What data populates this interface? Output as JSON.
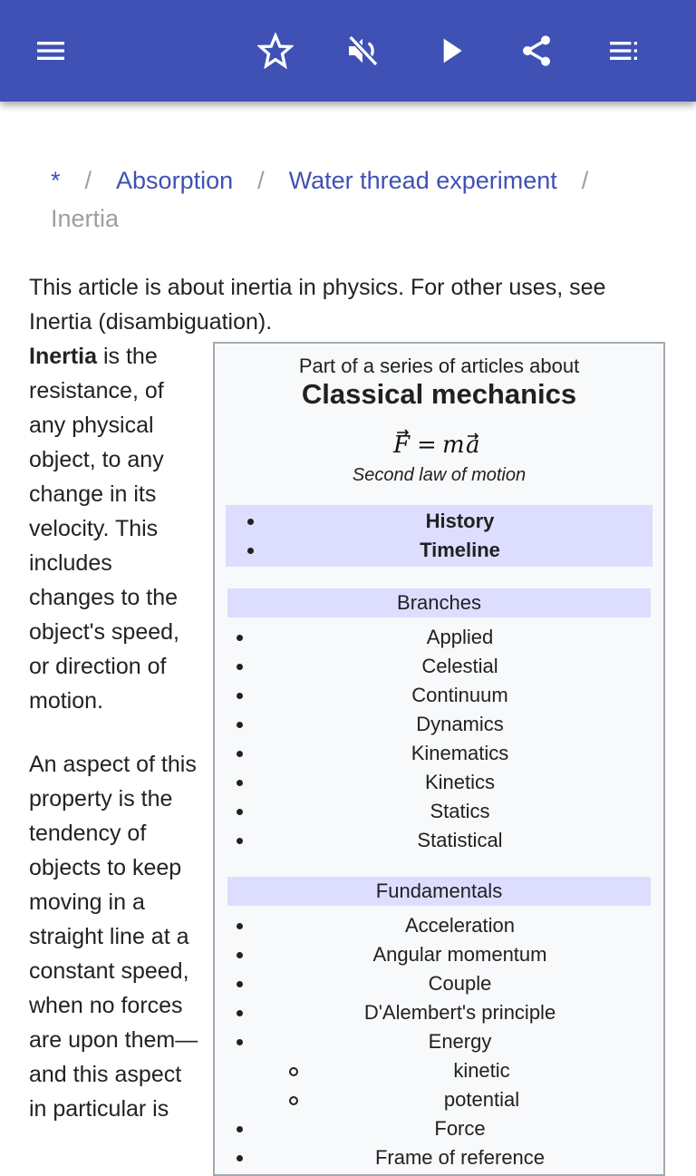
{
  "appbar": {
    "color": "#3f51b5",
    "icons": [
      "menu-icon",
      "star-icon",
      "volume-off-icon",
      "play-icon",
      "share-icon",
      "playlist-icon"
    ]
  },
  "breadcrumb": {
    "items": [
      "*",
      "Absorption",
      "Water thread experiment"
    ],
    "separator": "/",
    "current": "Inertia"
  },
  "article": {
    "hatnote": "This article is about inertia in physics. For other uses, see Inertia (disambiguation).",
    "p1_bold": "Inertia",
    "p1_rest": " is the resistance, of any physical object, to any change in its velocity. This includes changes to the object's speed, or direction of motion.",
    "p2": "An aspect of this property is the tendency of objects to keep moving in a straight line at a constant speed, when no forces are upon them—and this aspect in particular is"
  },
  "infobox": {
    "above": "Part of a series of articles about",
    "title": "Classical mechanics",
    "formula": "F = ma",
    "caption": "Second law of motion",
    "highlight": [
      "History",
      "Timeline"
    ],
    "sections": [
      {
        "title": "Branches",
        "items": [
          "Applied",
          "Celestial",
          "Continuum",
          "Dynamics",
          "Kinematics",
          "Kinetics",
          "Statics",
          "Statistical"
        ]
      },
      {
        "title": "Fundamentals",
        "items": [
          "Acceleration",
          "Angular momentum",
          "Couple",
          "D'Alembert's principle",
          "Energy"
        ],
        "subitems": [
          "kinetic",
          "potential"
        ],
        "after": [
          "Force",
          "Frame of reference"
        ]
      }
    ]
  }
}
